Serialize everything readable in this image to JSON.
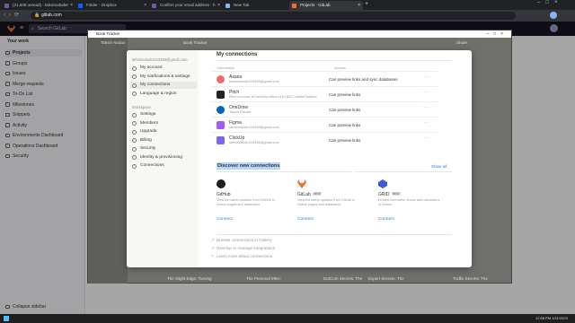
{
  "browser": {
    "tabs": [
      {
        "label": "(21,608 unread) - tahsinoduder",
        "color": "#6b5ca5"
      },
      {
        "label": "Folder - Dropbox",
        "color": "#0061fe"
      },
      {
        "label": "Confirm your email address - h",
        "color": "#6b5ca5"
      },
      {
        "label": "New Tab",
        "color": "#8ab4f8"
      },
      {
        "label": "Projects · GitLab",
        "color": "#fc6d26"
      }
    ],
    "url": "gitlab.com"
  },
  "gitlab": {
    "search_placeholder": "Search GitLab",
    "section": "Your work",
    "nav": [
      "Projects",
      "Groups",
      "Issues",
      "Merge requests",
      "To-Do List",
      "Milestones",
      "Snippets",
      "Activity",
      "Environments Dashboard",
      "Operations Dashboard",
      "Security"
    ],
    "collapse": "Collapse sidebar"
  },
  "notion": {
    "window_title": "Book Tracker",
    "sidebar_user": "Tahsin Nodun",
    "breadcrumb": "Book Tracker",
    "share": "Share",
    "bottom_cards": [
      "The Slight Edge: Turning",
      "The Personal MBA:",
      "DotCom Secrets: The",
      "Expert Secrets: The",
      "Traffic Secrets: The"
    ]
  },
  "settings": {
    "account_email": "tahsinoduder123456@gmail.com",
    "account_items": [
      {
        "label": "My account",
        "icon": "user-icon"
      },
      {
        "label": "My notifications & settings",
        "icon": "bell-icon"
      },
      {
        "label": "My connections",
        "icon": "link-icon"
      },
      {
        "label": "Language & region",
        "icon": "globe-icon"
      }
    ],
    "workspace_head": "Workspace",
    "workspace_items": [
      {
        "label": "Settings",
        "icon": "gear-icon"
      },
      {
        "label": "Members",
        "icon": "people-icon"
      },
      {
        "label": "Upgrade",
        "icon": "upgrade-icon"
      },
      {
        "label": "Billing",
        "icon": "card-icon"
      },
      {
        "label": "Security",
        "icon": "key-icon"
      },
      {
        "label": "Identity & provisioning",
        "icon": "id-icon"
      },
      {
        "label": "Connections",
        "icon": "grid-icon"
      }
    ]
  },
  "connections": {
    "title": "My connections",
    "col_connection": "Connection",
    "col_access": "Access",
    "rows": [
      {
        "name": "Asana",
        "sub": "tahsinoduder123456@gmail.com",
        "access": "Can preview links and sync databases",
        "color": "#f06a6a"
      },
      {
        "name": "Pitch",
        "sub": "Pitch Account: fb7ab0b0e-d4bd-4340-8017-a8a5e7aa6cfd",
        "access": "Can preview links",
        "color": "#222222"
      },
      {
        "name": "OneDrive",
        "sub": "Tahsin Oduder",
        "access": "Can preview links",
        "color": "#0364b8"
      },
      {
        "name": "Figma",
        "sub": "tahsinoduder123456@gmail.com",
        "access": "Can preview links",
        "color": "#a259ff"
      },
      {
        "name": "ClickUp",
        "sub": "tahsinoduder123456@gmail.com",
        "access": "Can preview links",
        "color": "#7b68ee"
      }
    ],
    "discover_title": "Discover new connections",
    "show_all": "Show all",
    "cards": [
      {
        "name": "GitHub",
        "badge": "",
        "desc": "View the latest updates from GitHub in Notion pages and databases",
        "button": "Connect",
        "color": "#1b1f23"
      },
      {
        "name": "GitLab",
        "badge": "NEW",
        "desc": "View the latest updates from GitLab in Notion pages and databases",
        "button": "Connect",
        "color": "#fc6d26"
      },
      {
        "name": "GRID",
        "badge": "NEW",
        "desc": "Embed interactive charts and calculators in Notion",
        "button": "Connect",
        "color": "#3b5bdb"
      }
    ],
    "links": [
      "Browse connections in Gallery",
      "Develop or manage integrations",
      "Learn more about connections"
    ]
  },
  "taskbar": {
    "time": "12:58 PM",
    "date": "1/21/2023"
  }
}
